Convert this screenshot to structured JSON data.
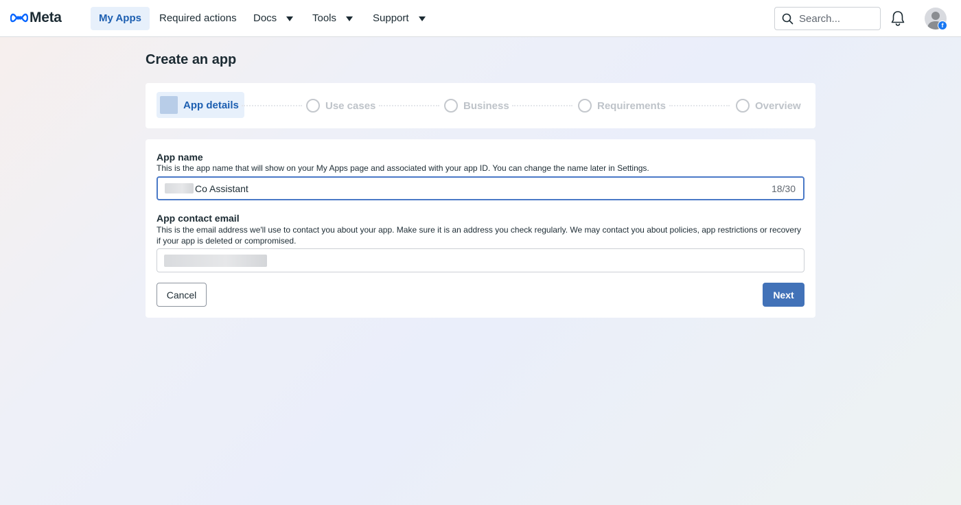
{
  "nav": {
    "brand": "Meta",
    "items": [
      {
        "label": "My Apps"
      },
      {
        "label": "Required actions"
      },
      {
        "label": "Docs"
      },
      {
        "label": "Tools"
      },
      {
        "label": "Support"
      }
    ],
    "search_placeholder": "Search...",
    "badge_letter": "f"
  },
  "page": {
    "title": "Create an app"
  },
  "steps": [
    {
      "label": "App details",
      "state": "active"
    },
    {
      "label": "Use cases",
      "state": "pending"
    },
    {
      "label": "Business",
      "state": "pending"
    },
    {
      "label": "Requirements",
      "state": "pending"
    },
    {
      "label": "Overview",
      "state": "pending"
    }
  ],
  "form": {
    "app_name": {
      "label": "App name",
      "help": "This is the app name that will show on your My Apps page and associated with your app ID. You can change the name later in Settings.",
      "value_visible": "Co Assistant",
      "counter": "18/30"
    },
    "app_email": {
      "label": "App contact email",
      "help": "This is the email address we'll use to contact you about your app. Make sure it is an address you check regularly. We may contact you about policies, app restrictions or recovery if your app is deleted or compromised."
    },
    "cancel_label": "Cancel",
    "next_label": "Next"
  },
  "colors": {
    "accent": "#1d5fb1",
    "primary_button": "#4272b8",
    "focus_border": "#4a79c7",
    "active_tab_bg": "#e7f0fb"
  }
}
